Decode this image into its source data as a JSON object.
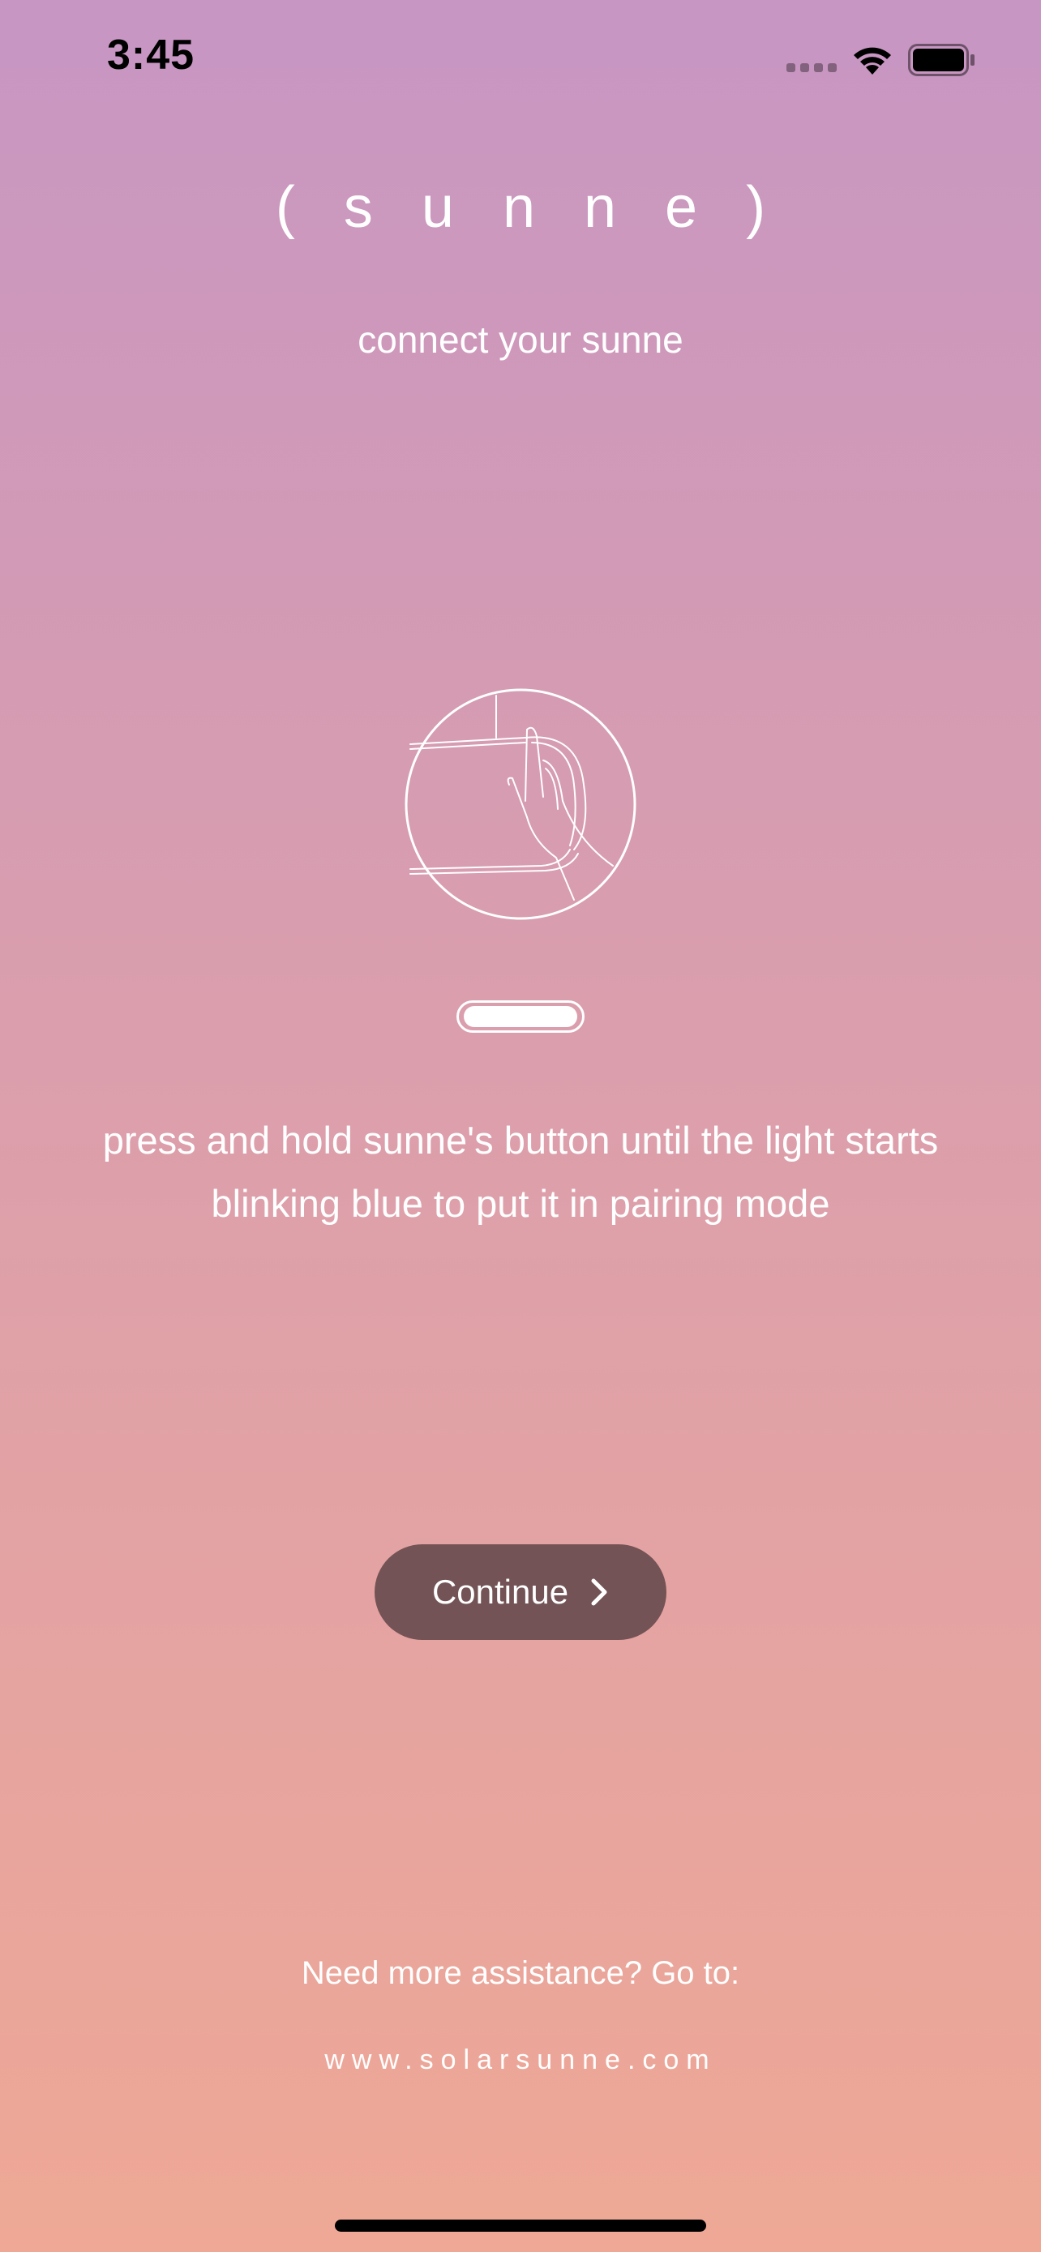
{
  "status_bar": {
    "time": "3:45",
    "icons": [
      "signal-icon",
      "wifi-icon",
      "battery-icon"
    ]
  },
  "logo": "(   s   u   n   n   e   )",
  "subtitle": "connect your sunne",
  "illustration": {
    "icon": "hand-pressing-lamp-icon"
  },
  "instructions": {
    "line1": "press and hold sunne's button until the light starts",
    "line2": "blinking blue to put it in pairing mode"
  },
  "continue_button": {
    "label": "Continue",
    "icon": "chevron-right-icon"
  },
  "help": {
    "text": "Need more assistance? Go to:",
    "url": "www.solarsunne.com"
  },
  "colors": {
    "gradient_top": "#c796c3",
    "gradient_bottom": "#efa895",
    "button": "#735355"
  }
}
